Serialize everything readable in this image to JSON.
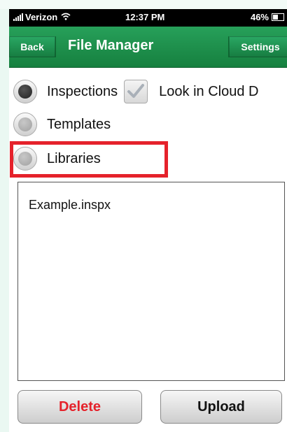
{
  "status_bar": {
    "carrier": "Verizon",
    "time": "12:37 PM",
    "battery": "46%"
  },
  "nav": {
    "back_label": "Back",
    "title": "File Manager",
    "settings_label": "Settings"
  },
  "options": {
    "inspections_label": "Inspections",
    "cloud_label": "Look in Cloud D",
    "templates_label": "Templates",
    "libraries_label": "Libraries",
    "selected": "Inspections",
    "cloud_checked": true
  },
  "files": [
    "Example.inspx"
  ],
  "buttons": {
    "delete_label": "Delete",
    "upload_label": "Upload"
  },
  "colors": {
    "nav_green": "#1f9150",
    "highlight_red": "#e5222b",
    "delete_red": "#e5222b"
  }
}
